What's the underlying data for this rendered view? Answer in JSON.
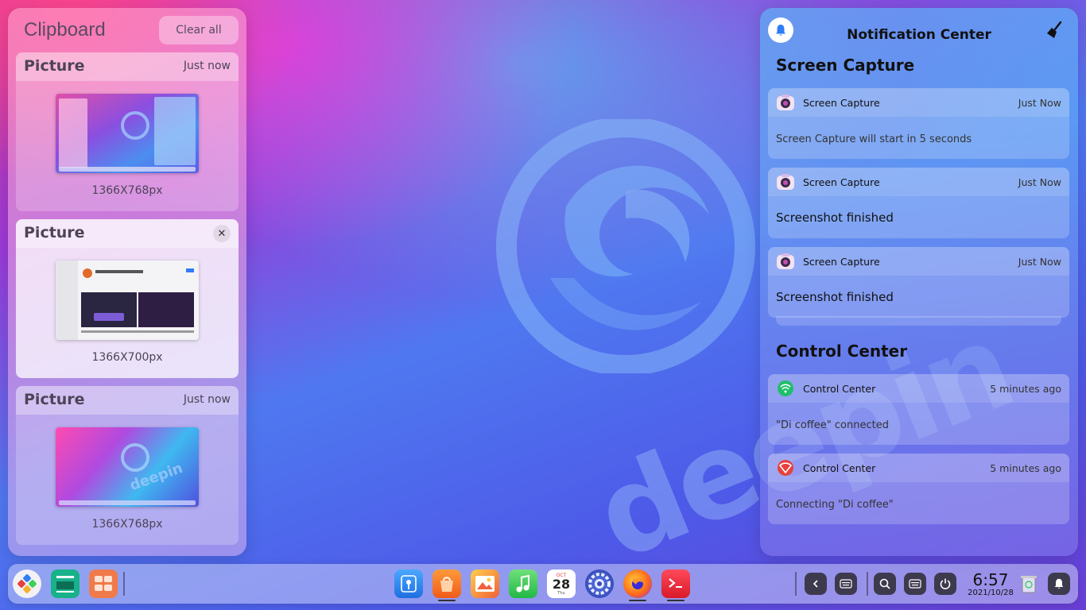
{
  "wallpaper": {
    "text": "deepin"
  },
  "clipboard": {
    "title": "Clipboard",
    "clear_label": "Clear all",
    "items": [
      {
        "type": "Picture",
        "time": "Just now",
        "dimensions": "1366X768px",
        "thumb": "desktop-screenshot"
      },
      {
        "type": "Picture",
        "time": "",
        "dimensions": "1366X700px",
        "thumb": "webpage-screenshot"
      },
      {
        "type": "Picture",
        "time": "Just now",
        "dimensions": "1366X768px",
        "thumb": "wallpaper-screenshot"
      }
    ]
  },
  "notification_center": {
    "title": "Notification Center",
    "groups": [
      {
        "title": "Screen Capture",
        "items": [
          {
            "app": "Screen Capture",
            "time": "Just Now",
            "body": "Screen Capture will start in 5 seconds"
          },
          {
            "app": "Screen Capture",
            "time": "Just Now",
            "body": "Screenshot finished"
          },
          {
            "app": "Screen Capture",
            "time": "Just Now",
            "body": "Screenshot finished"
          }
        ]
      },
      {
        "title": "Control Center",
        "items": [
          {
            "app": "Control Center",
            "time": "5 minutes ago",
            "body": "\"Di coffee\" connected"
          },
          {
            "app": "Control Center",
            "time": "5 minutes ago",
            "body": "Connecting \"Di coffee\""
          }
        ]
      }
    ]
  },
  "dock": {
    "apps": [
      "launcher-icon",
      "multitasking-icon",
      "workspace-icon",
      "file-manager-icon",
      "app-store-icon",
      "album-icon",
      "music-icon",
      "calendar-icon",
      "control-center-icon",
      "firefox-icon",
      "terminal-icon"
    ],
    "calendar": {
      "month": "OCT",
      "day": "28",
      "weekday": "Thu"
    },
    "clock": {
      "time": "6:57",
      "date": "2021/10/28"
    }
  },
  "colors": {
    "accent": "#2f7df6",
    "terminal": "#e8283d",
    "music": "#3fcf5a"
  }
}
